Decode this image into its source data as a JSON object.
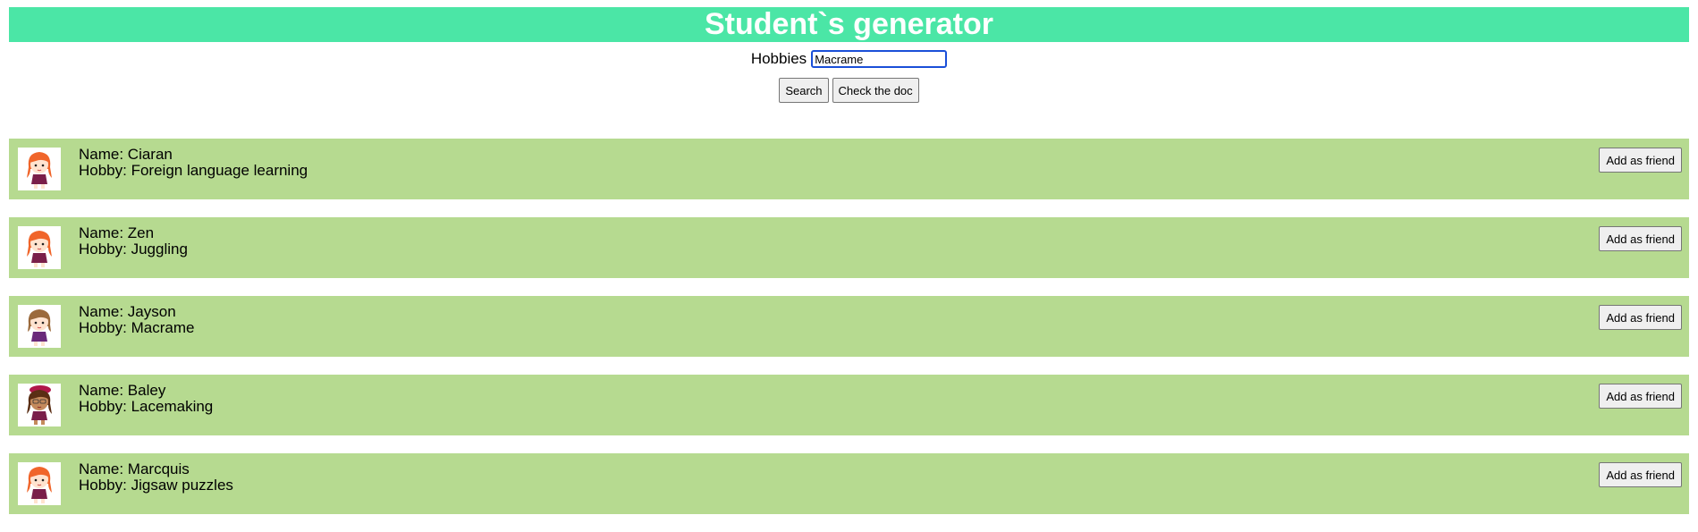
{
  "header": {
    "title": "Student`s generator"
  },
  "search": {
    "label": "Hobbies",
    "value": "Macrame"
  },
  "buttons": {
    "search": "Search",
    "check_doc": "Check the doc"
  },
  "students": [
    {
      "name_label": "Name: Ciaran",
      "hobby_label": "Hobby: Foreign language learning",
      "button": "Add as friend",
      "hair": "#f0652a",
      "outfit": "#7a1f4a"
    },
    {
      "name_label": "Name: Zen",
      "hobby_label": "Hobby: Juggling",
      "button": "Add as friend",
      "hair": "#f0652a",
      "outfit": "#7a1f4a"
    },
    {
      "name_label": "Name: Jayson",
      "hobby_label": "Hobby: Macrame",
      "button": "Add as friend",
      "hair": "#9b6a3c",
      "outfit": "#6a2a7a"
    },
    {
      "name_label": "Name: Baley",
      "hobby_label": "Hobby: Lacemaking",
      "button": "Add as friend",
      "hair": "#5a2e14",
      "outfit": "#7a1f4a"
    },
    {
      "name_label": "Name: Marcquis",
      "hobby_label": "Hobby: Jigsaw puzzles",
      "button": "Add as friend",
      "hair": "#f0652a",
      "outfit": "#7a1f4a"
    }
  ],
  "colors": {
    "header_bg": "#4be6a6",
    "card_bg": "#b6da90"
  }
}
